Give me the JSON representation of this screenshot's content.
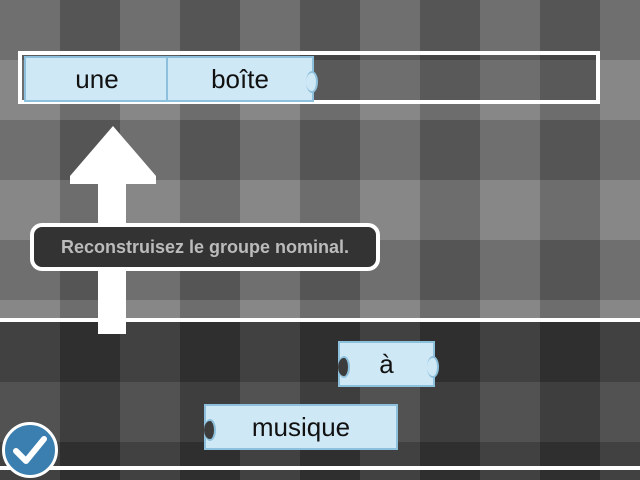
{
  "placed_words": [
    {
      "text": "une"
    },
    {
      "text": "boîte"
    }
  ],
  "available_words": [
    {
      "text": "à"
    },
    {
      "text": "musique"
    }
  ],
  "hint": "Reconstruisez le groupe nominal.",
  "colors": {
    "tile_fill": "#cfe8f6",
    "tile_border": "#8cc0dc",
    "check_button": "#3a7fb0",
    "hint_bg": "#333333"
  },
  "icons": {
    "arrow": "up-arrow-icon",
    "check": "checkmark-icon"
  }
}
